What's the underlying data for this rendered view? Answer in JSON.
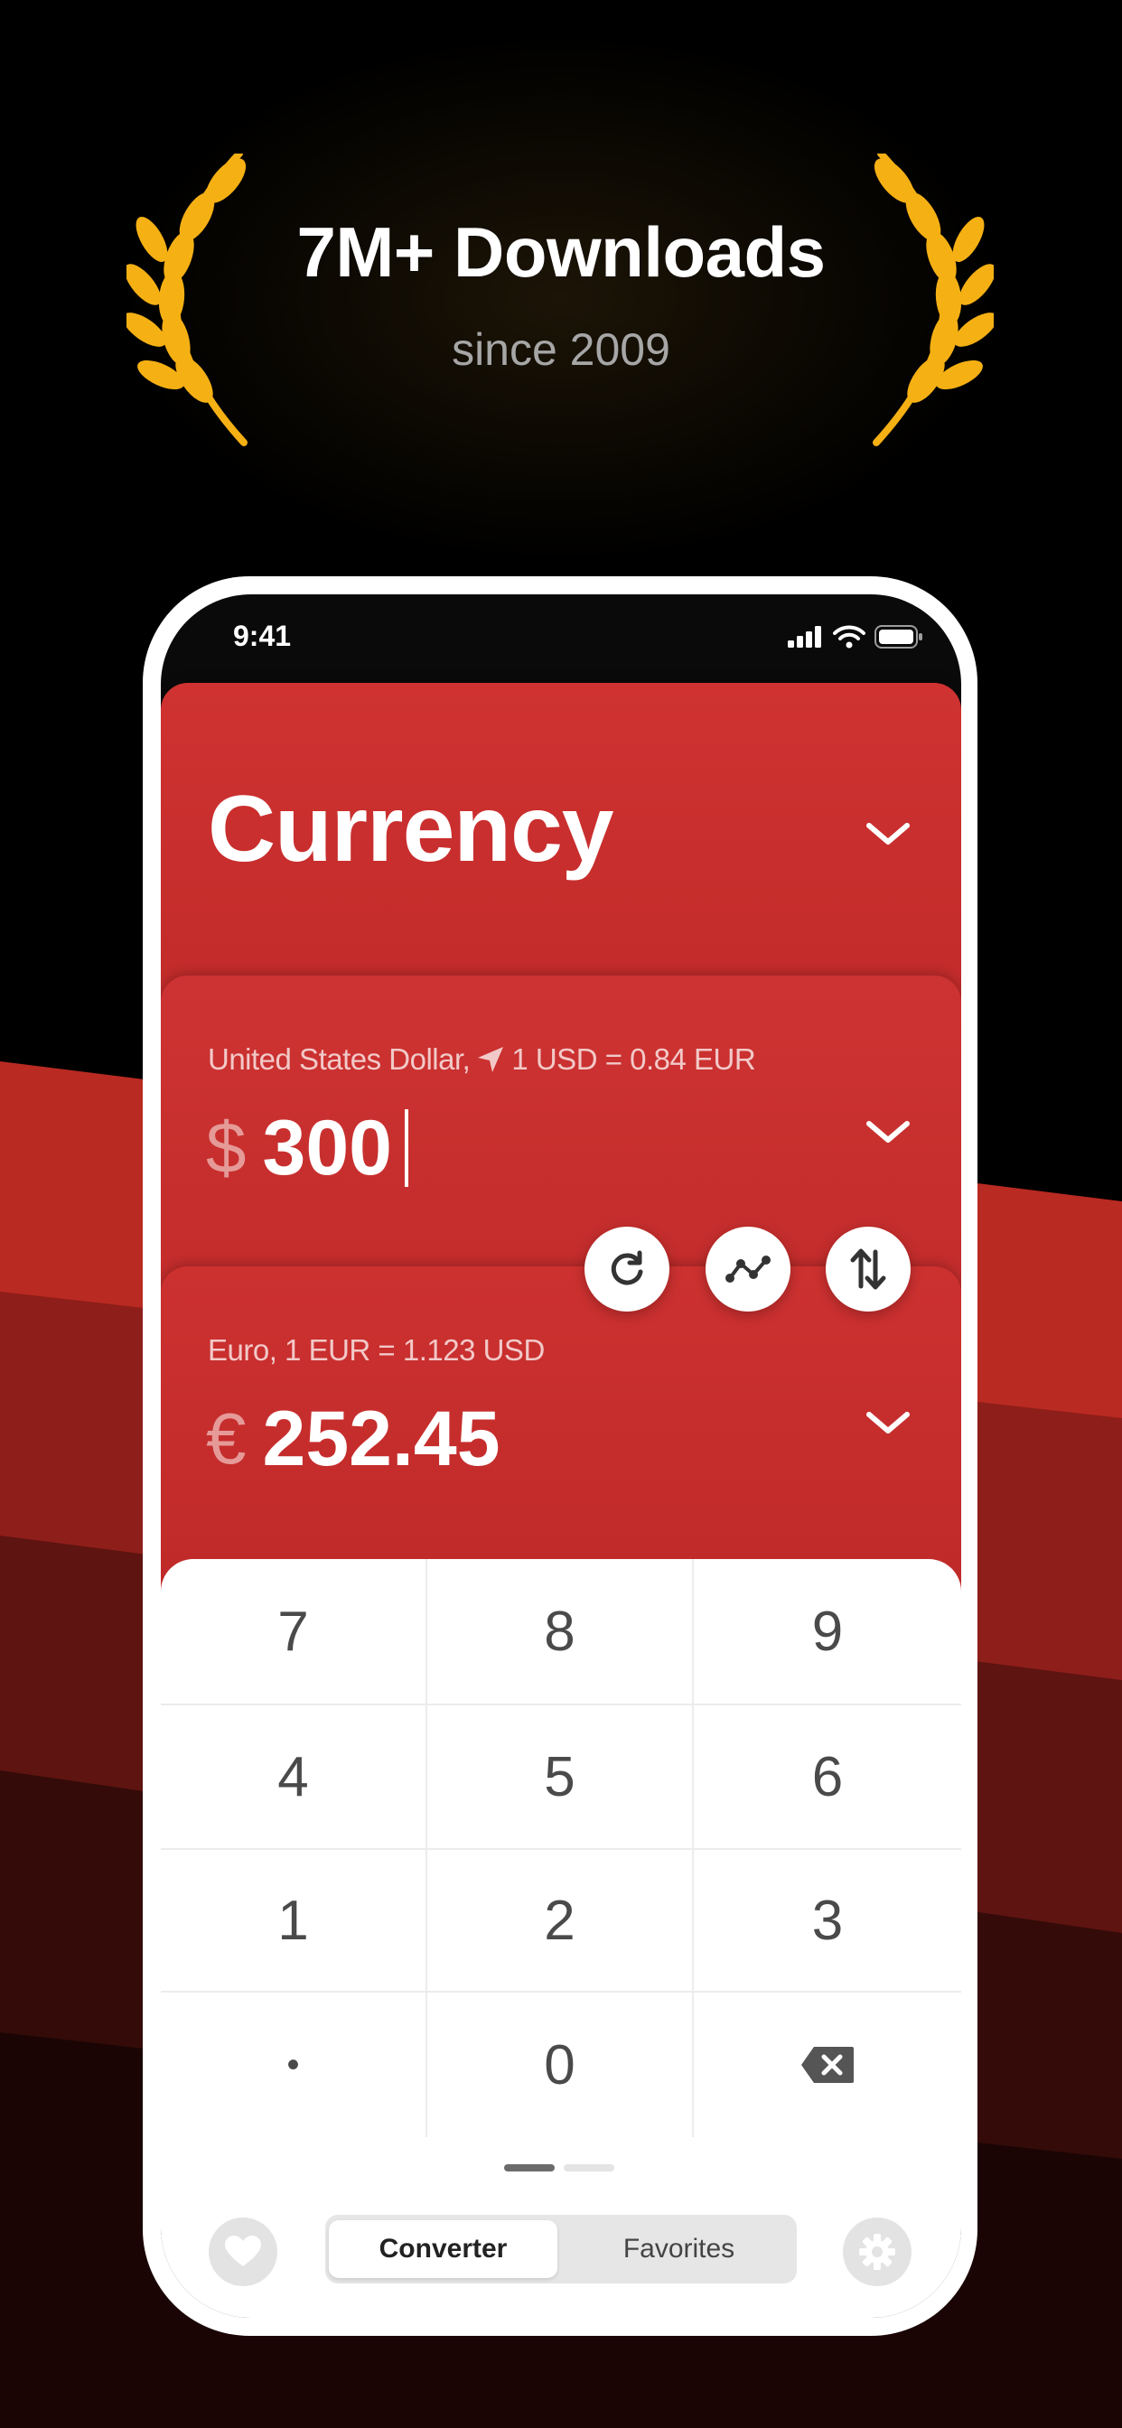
{
  "header": {
    "headline": "7M+ Downloads",
    "subline": "since 2009",
    "laurel_color": "#f5b014"
  },
  "status_bar": {
    "time": "9:41",
    "icons": [
      "cellular-signal-icon",
      "wifi-icon",
      "battery-icon"
    ]
  },
  "title_card": {
    "title": "Currency",
    "color": "#c52e2d"
  },
  "from_currency": {
    "name": "United States Dollar,",
    "rate": "1 USD = 0.84 EUR",
    "symbol": "$",
    "amount": "300",
    "icon": "location-arrow-icon"
  },
  "to_currency": {
    "label": "Euro, 1 EUR = 1.123 USD",
    "symbol": "€",
    "amount": "252.45"
  },
  "actions": [
    "refresh-icon",
    "chart-icon",
    "swap-icon"
  ],
  "keypad": {
    "keys": [
      "7",
      "8",
      "9",
      "4",
      "5",
      "6",
      "1",
      "2",
      "3",
      "•",
      "0",
      "backspace"
    ]
  },
  "tabbar": {
    "segments": [
      "Converter",
      "Favorites"
    ],
    "active": "Converter",
    "left_icon": "heart-icon",
    "right_icon": "gear-icon"
  }
}
